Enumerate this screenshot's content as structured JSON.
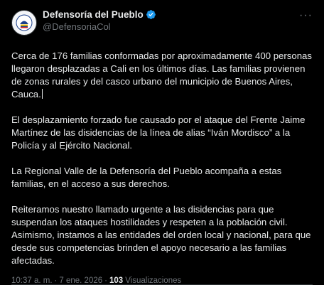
{
  "header": {
    "display_name": "Defensoría del Pueblo",
    "handle": "@DefensoriaCol",
    "more_label": "···"
  },
  "body": {
    "paragraphs": [
      "Cerca de 176 familias conformadas por aproximadamente 400 personas llegaron desplazadas a Cali en los últimos días. Las familias provienen de zonas rurales y del casco urbano del municipio de Buenos Aires, Cauca.",
      "El desplazamiento forzado fue causado por el ataque del Frente Jaime Martínez de las disidencias de la línea de alias “Iván Mordisco” a la Policía y al Ejército Nacional.",
      "La Regional Valle de la Defensoría del Pueblo acompaña a estas familias, en el acceso a sus derechos.",
      "Reiteramos nuestro llamado urgente a las disidencias para que suspendan los ataques hostilidades y respeten a la población civil. Asimismo, instamos a las entidades del orden local y nacional, para que desde sus competencias brinden el apoyo necesario a las familias afectadas."
    ]
  },
  "meta": {
    "time": "10:37 a. m.",
    "separator": "·",
    "date": "7 ene. 2026",
    "views_count": "103",
    "views_label": "Visualizaciones"
  },
  "colors": {
    "background": "#000000",
    "text": "#e7e9ea",
    "muted": "#71767b",
    "verified": "#1d9bf0"
  }
}
